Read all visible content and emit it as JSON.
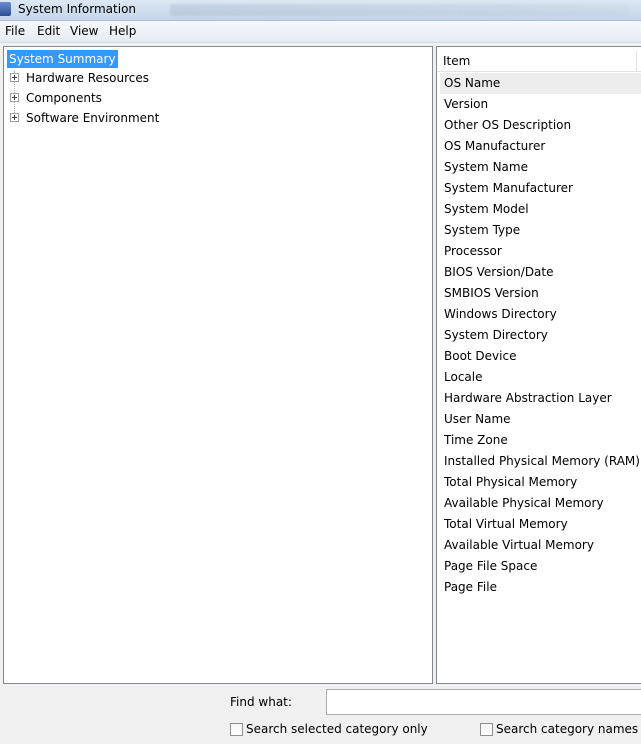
{
  "window": {
    "title": "System Information"
  },
  "menu": [
    "File",
    "Edit",
    "View",
    "Help"
  ],
  "tree": {
    "root": "System Summary",
    "children": [
      "Hardware Resources",
      "Components",
      "Software Environment"
    ]
  },
  "list": {
    "column_header": "Item",
    "items": [
      "OS Name",
      "Version",
      "Other OS Description",
      "OS Manufacturer",
      "System Name",
      "System Manufacturer",
      "System Model",
      "System Type",
      "Processor",
      "BIOS Version/Date",
      "SMBIOS Version",
      "Windows Directory",
      "System Directory",
      "Boot Device",
      "Locale",
      "Hardware Abstraction Layer",
      "User Name",
      "Time Zone",
      "Installed Physical Memory (RAM)",
      "Total Physical Memory",
      "Available Physical Memory",
      "Total Virtual Memory",
      "Available Virtual Memory",
      "Page File Space",
      "Page File"
    ]
  },
  "search": {
    "find_label": "Find what:",
    "find_value": "",
    "option_selected_only": "Search selected category only",
    "option_category_names": "Search category names only"
  },
  "colors": {
    "selection": "#3399ff",
    "title_bar": "#c4d6ea"
  }
}
